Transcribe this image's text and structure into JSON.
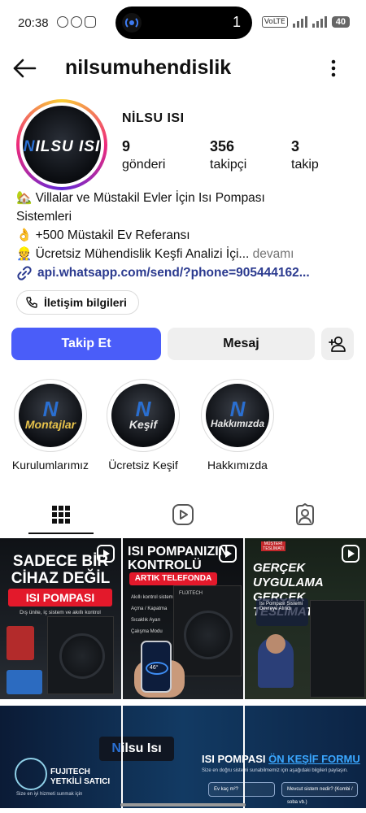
{
  "status_bar": {
    "time": "20:38",
    "pill_count": "1",
    "network_badge": "VoLTE",
    "sim_numbers": "1 2",
    "battery": "40"
  },
  "header": {
    "username": "nilsumuhendislik",
    "back_icon": "arrow-left-icon",
    "menu_icon": "vertical-dots-icon"
  },
  "profile": {
    "display_name": "NİLSU ISI",
    "avatar_logo_prefix": "N",
    "avatar_logo_text": "ILSU ISI",
    "stats": [
      {
        "value": "9",
        "label": "gönderi"
      },
      {
        "value": "356",
        "label": "takipçi"
      },
      {
        "value": "3",
        "label": "takip"
      }
    ],
    "bio": {
      "line1": "🏡 Villalar ve Müstakil Evler İçin Isı Pompası",
      "line2": "Sistemleri",
      "line3": "👌 +500 Müstakil Ev Referansı",
      "line4": "👷 Ücretsiz Mühendislik Keşfi Analizi İçi...",
      "more": " devamı"
    },
    "link": "api.whatsapp.com/send/?phone=905444162...",
    "contact_button": "İletişim bilgileri"
  },
  "actions": {
    "follow": "Takip Et",
    "message": "Mesaj",
    "add_user_icon": "add-person-icon"
  },
  "highlights": [
    {
      "label": "Kurulumlarımız",
      "cover_text": "Montajlar"
    },
    {
      "label": "Ücretsiz Keşif",
      "cover_text": "Keşif"
    },
    {
      "label": "Hakkımızda",
      "cover_text": "Hakkımızda"
    }
  ],
  "tabs": [
    {
      "icon": "grid-icon",
      "active": true
    },
    {
      "icon": "reels-icon",
      "active": false
    },
    {
      "icon": "tagged-icon",
      "active": false
    }
  ],
  "posts": {
    "p1": {
      "headline": "SADECE BİR CİHAZ DEĞİL",
      "banner": "ISI POMPASI",
      "sub": "Dış ünite, iç sistem ve akıllı kontrol"
    },
    "p2": {
      "headline": "ISI POMPANIZIN KONTROLÜ",
      "banner": "ARTIK TELEFONDA",
      "items": [
        "Akıllı kontrol sistemi",
        "Açma / Kapatma",
        "Sıcaklık Ayarı",
        "Çalışma Modu"
      ],
      "brand": "FUJITECH",
      "temp": "46°"
    },
    "p3": {
      "badge": "MÜŞTERİ TESLİMATI",
      "headline": "GERÇEK UYGULAMA GERÇEK TESLİMAT",
      "card": "Isı Pompası Sistemi Devreye Alındı"
    },
    "p4": {
      "logo_prefix": "N",
      "logo_text": "ilsu Isı",
      "certified": "FUJITECH YETKİLİ SATICI",
      "certified_sub": "Size en iyi hizmeti sunmak için",
      "title_main": "ISI POMPASI ",
      "title_accent": "ÖN KEŞİF FORMU",
      "form_sub": "Size en doğru sistemi sunabilmemiz için aşağıdaki bilgileri paylaşın.",
      "field1": "Ev kaç m²?",
      "field2": "Mevcut sistem nedir? (Kombi / soba vb.)"
    }
  }
}
